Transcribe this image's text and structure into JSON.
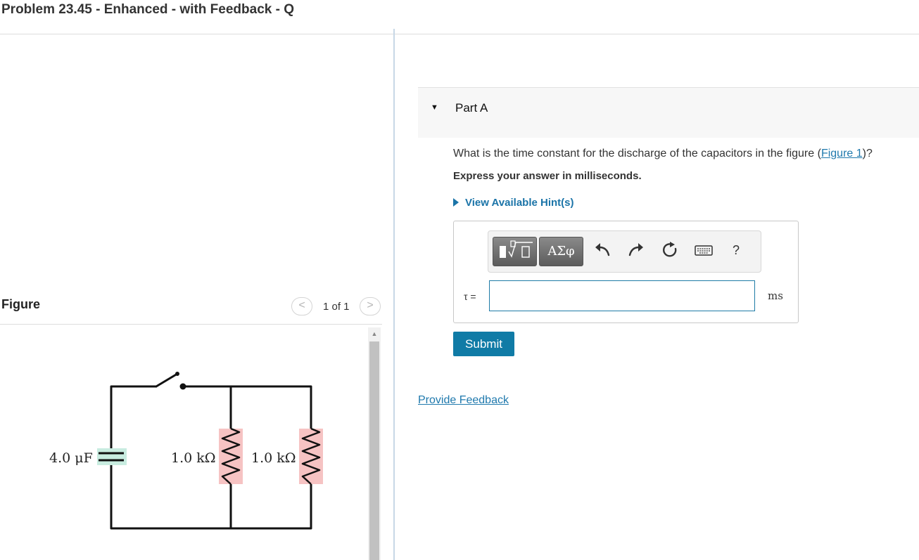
{
  "header": {
    "title": "Problem 23.45 - Enhanced - with Feedback - Q"
  },
  "figure_pane": {
    "label": "Figure",
    "pager": {
      "text": "1 of 1",
      "prev": "<",
      "next": ">"
    },
    "circuit": {
      "capacitor_label": "4.0 μF",
      "resistor1_label": "1.0 kΩ",
      "resistor2_label": "1.0 kΩ",
      "capacitor_color": "#c8ece0",
      "resistor_color": "#f6c3c3"
    }
  },
  "part": {
    "label": "Part A",
    "question_prefix": "What is the time constant for the discharge of the capacitors in the figure (",
    "question_link": "Figure 1",
    "question_suffix": ")?",
    "instruction": "Express your answer in milliseconds.",
    "hint_label": "View Available Hint(s)",
    "answer": {
      "variable_label": "τ =",
      "input_value": "",
      "units": "ms",
      "toolbar": {
        "symbols_label": "ΑΣφ",
        "help_label": "?",
        "icons": [
          "templates-icon",
          "greek-symbols-icon",
          "undo-icon",
          "redo-icon",
          "reset-icon",
          "keyboard-icon",
          "help-icon"
        ]
      }
    },
    "submit_label": "Submit"
  },
  "feedback_label": "Provide Feedback",
  "colors": {
    "accent": "#107ba6",
    "link": "#1f79ad",
    "input_border": "#1e7ba6"
  }
}
